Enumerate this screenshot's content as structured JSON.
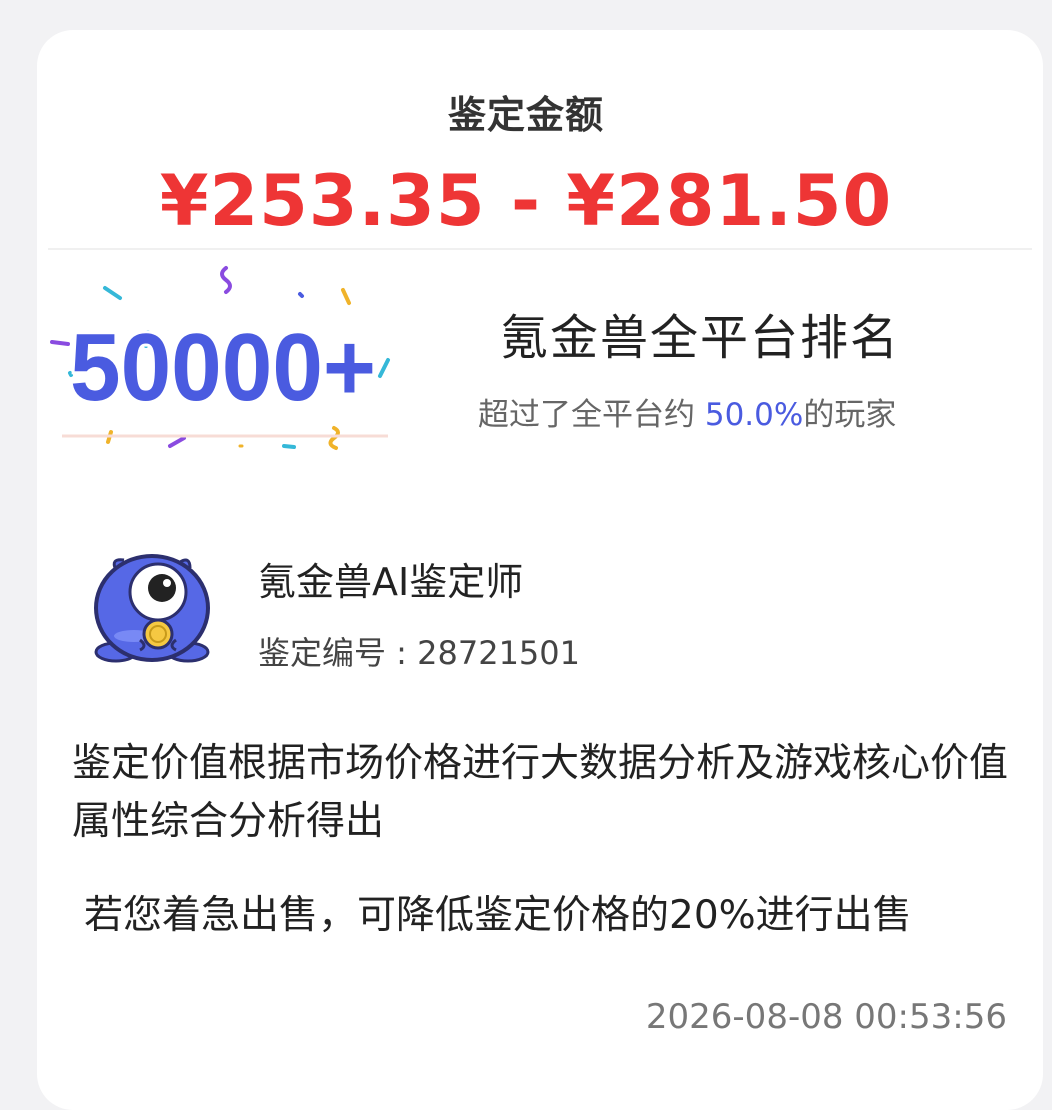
{
  "appraisal": {
    "title": "鉴定金额",
    "price_range": "¥253.35 - ¥281.50"
  },
  "ranking": {
    "badge_number": "50000+",
    "title": "氪金兽全平台排名",
    "summary_prefix": "超过了全平台约 ",
    "summary_percent": "50.0%",
    "summary_suffix": "的玩家"
  },
  "appraiser": {
    "name": "氪金兽AI鉴定师",
    "number_label": "鉴定编号 : 28721501"
  },
  "notes": {
    "description": " 鉴定价值根据市场价格进行大数据分析及游戏核心价值属性综合分析得出",
    "quick_sale": "若您着急出售，可降低鉴定价格的20%进行出售"
  },
  "timestamp": "2026-08-08 00:53:56",
  "colors": {
    "price": "#ee3535",
    "accent_blue": "#4a5be0",
    "card_background": "#ffffff"
  }
}
